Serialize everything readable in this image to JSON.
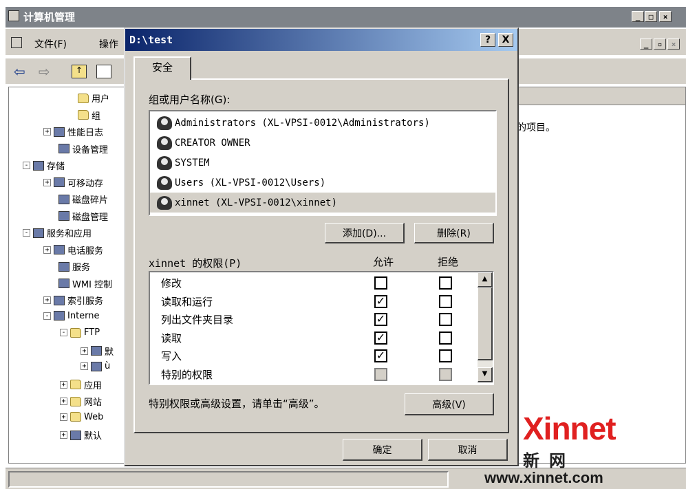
{
  "bg_window": {
    "title": "计算机管理",
    "menu": [
      "文件(F)",
      "操作"
    ],
    "right_text": "的项目。",
    "tree": [
      {
        "label": "用户",
        "icon": "folder-icon"
      },
      {
        "label": "组",
        "icon": "folder-icon"
      },
      {
        "label": "性能日志",
        "icon": "perf-log-icon",
        "expander": "+"
      },
      {
        "label": "设备管理",
        "icon": "device-manager-icon"
      },
      {
        "label": "存储",
        "icon": "storage-icon",
        "expander": "-"
      },
      {
        "label": "可移动存",
        "icon": "removable-storage-icon",
        "expander": "+"
      },
      {
        "label": "磁盘碎片",
        "icon": "defrag-icon"
      },
      {
        "label": "磁盘管理",
        "icon": "disk-management-icon"
      },
      {
        "label": "服务和应用",
        "icon": "services-apps-icon",
        "expander": "-"
      },
      {
        "label": "电话服务",
        "icon": "telephony-icon",
        "expander": "+"
      },
      {
        "label": "服务",
        "icon": "services-icon"
      },
      {
        "label": "WMI 控制",
        "icon": "wmi-icon"
      },
      {
        "label": "索引服务",
        "icon": "indexing-icon",
        "expander": "+"
      },
      {
        "label": "Interne",
        "icon": "iis-icon",
        "expander": "-"
      },
      {
        "label": "FTP",
        "icon": "folder-icon",
        "expander": "-"
      },
      {
        "label": "默",
        "icon": "ftp-site-icon",
        "expander": "+"
      },
      {
        "label": "ù",
        "icon": "ftp-site-icon",
        "expander": "+"
      },
      {
        "label": "应用",
        "icon": "folder-icon",
        "expander": "+"
      },
      {
        "label": "网站",
        "icon": "folder-icon",
        "expander": "+"
      },
      {
        "label": "Web",
        "icon": "folder-icon",
        "expander": "+"
      },
      {
        "label": "默认",
        "icon": "default-smtp-icon",
        "expander": "+"
      }
    ]
  },
  "dialog": {
    "title": "D:\\test",
    "help_label": "?",
    "close_label": "X",
    "tab_label": "安全",
    "group_label": "组或用户名称(G):",
    "groups": [
      {
        "name": "Administrators (XL-VPSI-0012\\Administrators)",
        "selected": false
      },
      {
        "name": "CREATOR OWNER",
        "selected": false
      },
      {
        "name": "SYSTEM",
        "selected": false
      },
      {
        "name": "Users (XL-VPSI-0012\\Users)",
        "selected": false
      },
      {
        "name": "xinnet (XL-VPSI-0012\\xinnet)",
        "selected": true
      }
    ],
    "add_button": "添加(D)...",
    "remove_button": "删除(R)",
    "perm_label": "xinnet 的权限(P)",
    "allow_header": "允许",
    "deny_header": "拒绝",
    "permissions": [
      {
        "name": "修改",
        "allow": "",
        "deny": "",
        "allow_disabled": false,
        "deny_disabled": false
      },
      {
        "name": "读取和运行",
        "allow": "✓",
        "deny": "",
        "allow_disabled": false,
        "deny_disabled": false
      },
      {
        "name": "列出文件夹目录",
        "allow": "✓",
        "deny": "",
        "allow_disabled": false,
        "deny_disabled": false
      },
      {
        "name": "读取",
        "allow": "✓",
        "deny": "",
        "allow_disabled": false,
        "deny_disabled": false
      },
      {
        "name": "写入",
        "allow": "✓",
        "deny": "",
        "allow_disabled": false,
        "deny_disabled": false
      },
      {
        "name": "特别的权限",
        "allow": "",
        "deny": "",
        "allow_disabled": true,
        "deny_disabled": true
      }
    ],
    "advanced_hint": "特别权限或高级设置，请单击“高级”。",
    "advanced_button": "高级(V)",
    "ok_button": "确定",
    "cancel_button": "取消"
  },
  "watermark": {
    "brand": "Xinnet",
    "chinese": "新网",
    "url": "www.xinnet.com"
  }
}
